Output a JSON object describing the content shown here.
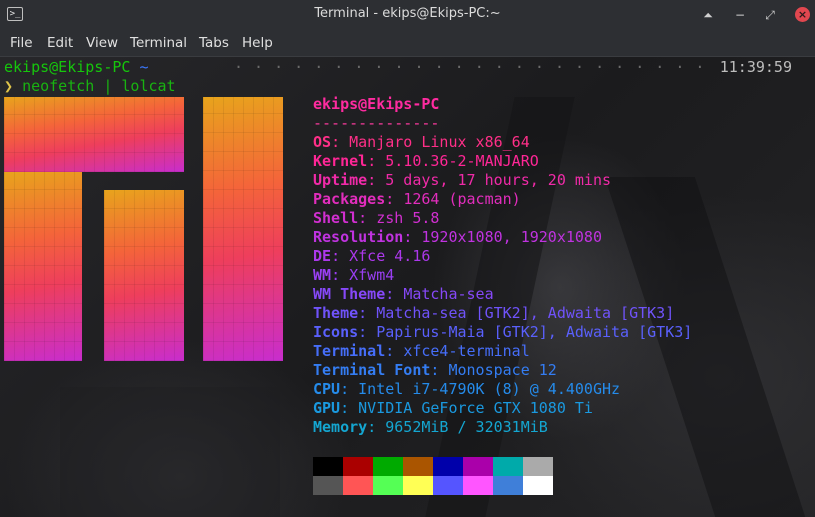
{
  "window": {
    "title": "Terminal - ekips@Ekips-PC:~",
    "app_icon_glyph": ">_",
    "controls": {
      "shade": "⏶",
      "minimize": "−",
      "maximize": "⤢",
      "close": "×"
    }
  },
  "menu": [
    "File",
    "Edit",
    "View",
    "Terminal",
    "Tabs",
    "Help"
  ],
  "terminal": {
    "prompt": {
      "user_host": "ekips@Ekips-PC",
      "path": "~",
      "time": "11:39:59"
    },
    "command": {
      "arrow": "❯",
      "text": "neofetch | lolcat"
    },
    "info_title": "ekips@Ekips-PC",
    "separator": "--------------",
    "info": [
      {
        "key": "OS",
        "value": "Manjaro Linux x86_64",
        "color": "#ff2f88"
      },
      {
        "key": "Kernel",
        "value": "5.10.36-2-MANJARO",
        "color": "#ff2696"
      },
      {
        "key": "Uptime",
        "value": "5 days, 17 hours, 20 mins",
        "color": "#f02aa8"
      },
      {
        "key": "Packages",
        "value": "1264 (pacman)",
        "color": "#e22dbd"
      },
      {
        "key": "Shell",
        "value": "zsh 5.8",
        "color": "#d12fd0"
      },
      {
        "key": "Resolution",
        "value": "1920x1080, 1920x1080",
        "color": "#c033e0"
      },
      {
        "key": "DE",
        "value": "Xfce 4.16",
        "color": "#ac38ec"
      },
      {
        "key": "WM",
        "value": "Xfwm4",
        "color": "#9a3ff3"
      },
      {
        "key": "WM Theme",
        "value": "Matcha-sea",
        "color": "#8648f8"
      },
      {
        "key": "Theme",
        "value": "Matcha-sea [GTK2], Adwaita [GTK3]",
        "color": "#7053fb"
      },
      {
        "key": "Icons",
        "value": "Papirus-Maia [GTK2], Adwaita [GTK3]",
        "color": "#5a60fc"
      },
      {
        "key": "Terminal",
        "value": "xfce4-terminal",
        "color": "#466ef9"
      },
      {
        "key": "Terminal Font",
        "value": "Monospace 12",
        "color": "#347df3"
      },
      {
        "key": "CPU",
        "value": "Intel i7-4790K (8) @ 4.400GHz",
        "color": "#258bea"
      },
      {
        "key": "GPU",
        "value": "NVIDIA GeForce GTX 1080 Ti",
        "color": "#1a99df"
      },
      {
        "key": "Memory",
        "value": "9652MiB / 32031MiB",
        "color": "#14a6d1"
      }
    ],
    "palette_row1": [
      "#000000",
      "#aa0000",
      "#00aa00",
      "#aa5500",
      "#0000aa",
      "#aa00aa",
      "#00aaaa",
      "#aaaaaa"
    ],
    "palette_row2": [
      "#555555",
      "#ff5555",
      "#55ff55",
      "#ffff55",
      "#5555ff",
      "#ff55ff",
      "#3f7fd9",
      "#ffffff"
    ]
  }
}
